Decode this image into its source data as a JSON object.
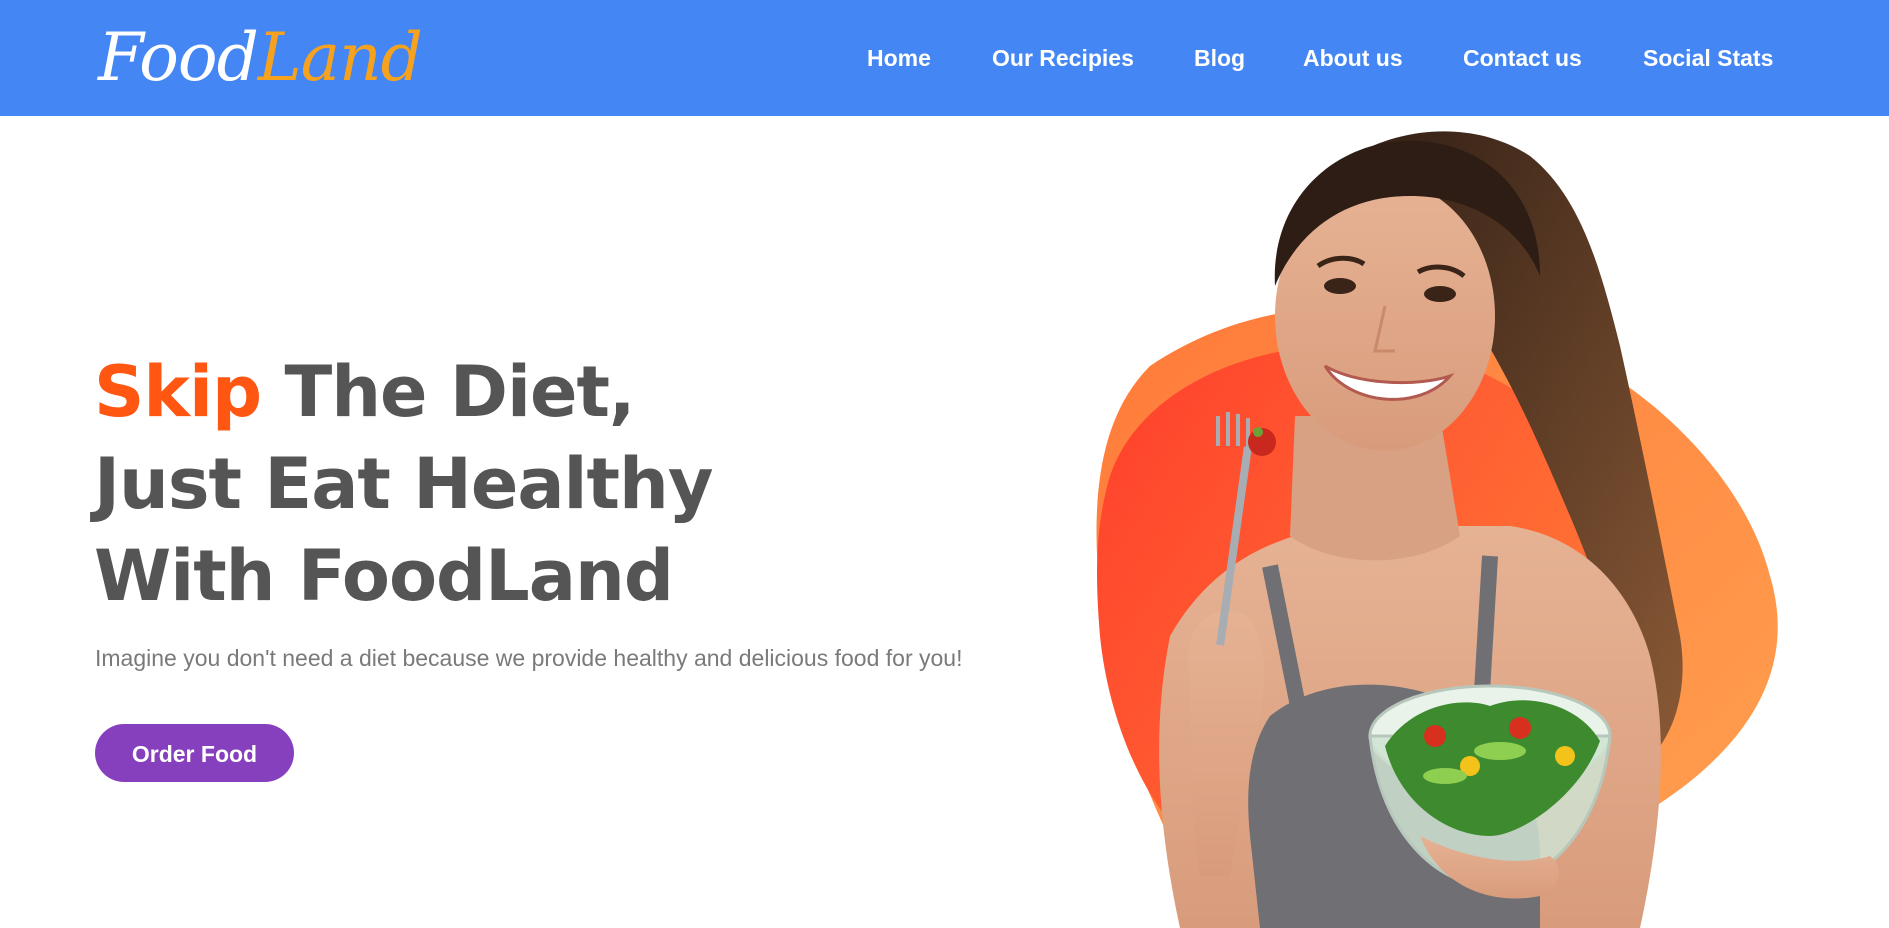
{
  "brand": {
    "logo_part1": "Food",
    "logo_part2": "Land",
    "primary_color": "#4486f3",
    "accent_color": "#f6a21e"
  },
  "nav": {
    "items": [
      {
        "label": "Home"
      },
      {
        "label": "Our Recipies"
      },
      {
        "label": "Blog"
      },
      {
        "label": "About us"
      },
      {
        "label": "Contact us"
      },
      {
        "label": "Social Stats"
      }
    ]
  },
  "hero": {
    "headline_accent": "Skip",
    "headline_rest_line1": " The Diet,",
    "headline_line2": "Just Eat Healthy",
    "headline_line3": "With FoodLand",
    "subtitle": "Imagine you don't need a diet because we provide healthy and delicious food for you!",
    "cta_label": "Order Food",
    "cta_color": "#8640be",
    "headline_accent_color": "#ff5612",
    "image": {
      "description_icon": "woman-eating-salad-photo",
      "blob_colors": [
        "#ff4d2e",
        "#ff9545"
      ]
    }
  }
}
